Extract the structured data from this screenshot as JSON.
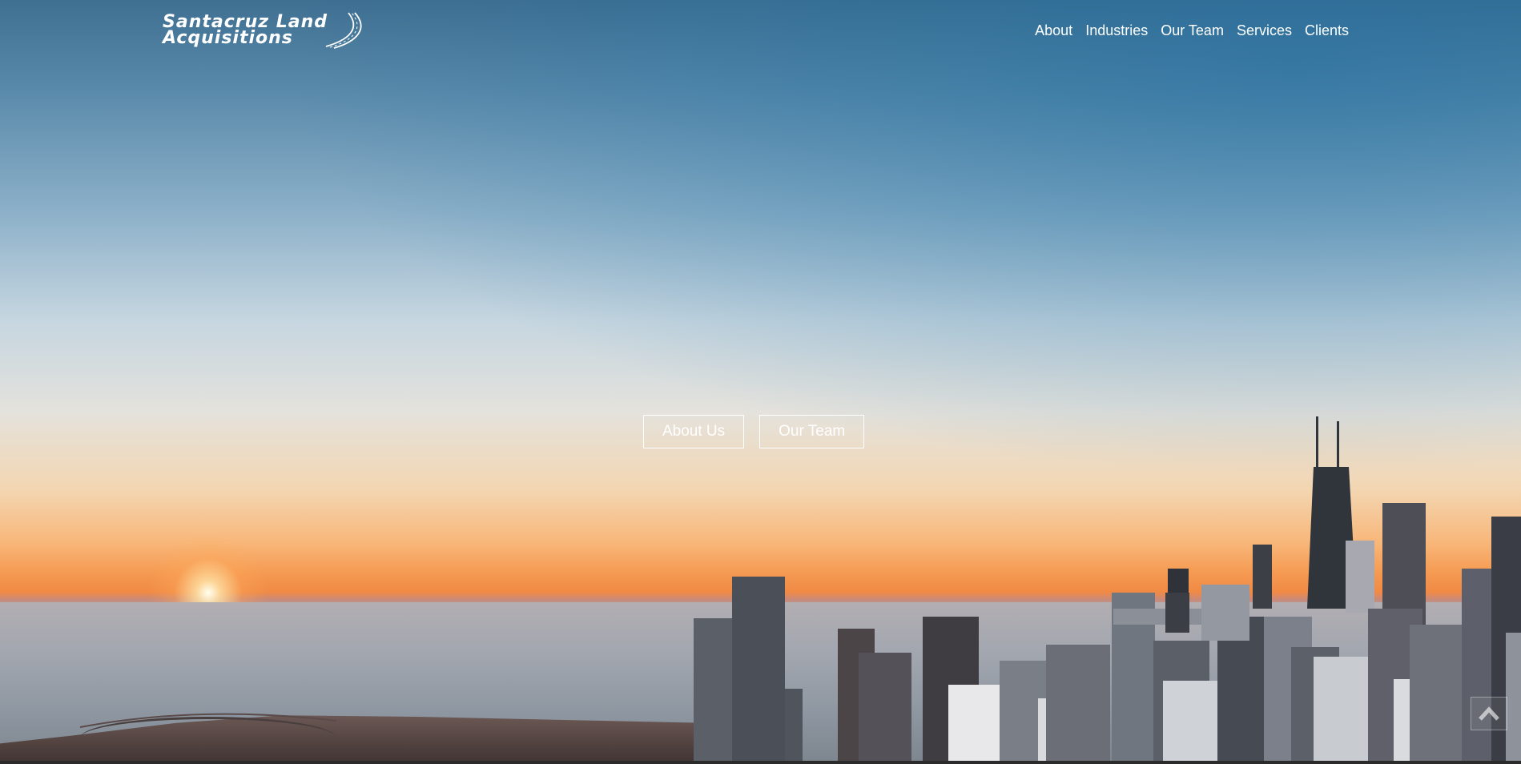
{
  "header": {
    "logo": {
      "line1": "Santacruz Land",
      "line2": "Acquisitions"
    },
    "nav": [
      {
        "label": "About"
      },
      {
        "label": "Industries"
      },
      {
        "label": "Our Team"
      },
      {
        "label": "Services"
      },
      {
        "label": "Clients"
      }
    ]
  },
  "hero": {
    "buttons": [
      {
        "label": "About Us"
      },
      {
        "label": "Our Team"
      }
    ]
  },
  "icons": {
    "logo_mark": "road-swoosh-icon",
    "back_to_top": "chevron-up-icon"
  },
  "colors": {
    "nav_text": "#ffffff",
    "button_border": "#ffffff",
    "sky_top": "#3f6f91",
    "horizon": "#f59a52"
  }
}
